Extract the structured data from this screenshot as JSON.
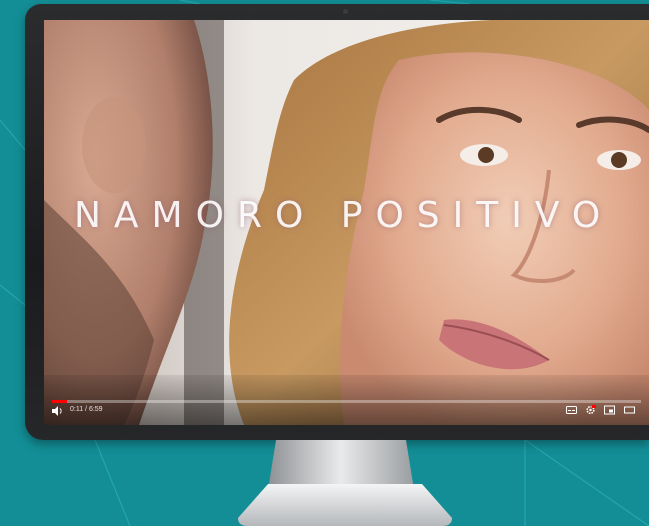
{
  "video": {
    "title": "NAMORO POSITIVO",
    "current_time": "0:11",
    "duration": "6:59",
    "time_text": "0:11 / 6:59",
    "progress": 0.026
  },
  "icons": {
    "volume": "volume-icon",
    "subtitles": "subtitles-icon",
    "settings": "settings-gear-icon",
    "miniplayer": "miniplayer-icon",
    "theater": "theater-mode-icon"
  },
  "colors": {
    "background": "#138e96",
    "bezel": "#1f2022",
    "progress": "#ff0000"
  }
}
